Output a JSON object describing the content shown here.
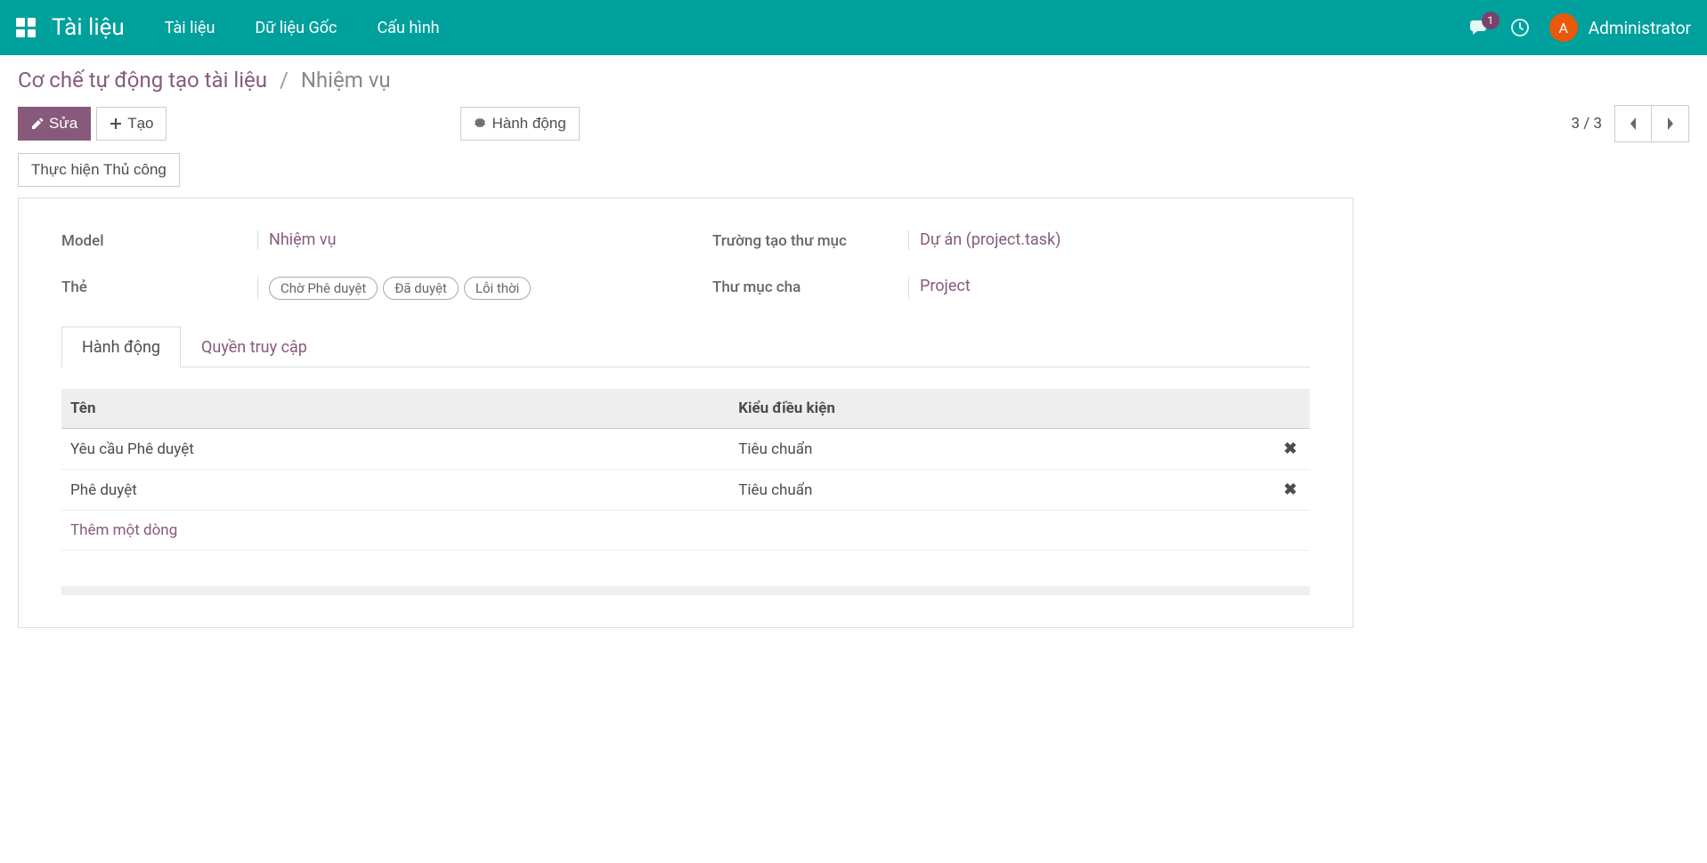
{
  "nav": {
    "brand": "Tài liệu",
    "menu": [
      "Tài liệu",
      "Dữ liệu Gốc",
      "Cấu hình"
    ],
    "badge_count": "1",
    "user_initial": "A",
    "user_name": "Administrator"
  },
  "breadcrumb": {
    "parent": "Cơ chế tự động tạo tài liệu",
    "current": "Nhiệm vụ"
  },
  "buttons": {
    "edit": "Sửa",
    "create": "Tạo",
    "action": "Hành động",
    "manual": "Thực hiện Thủ công"
  },
  "pager": {
    "text": "3 / 3"
  },
  "form": {
    "model_label": "Model",
    "model_value": "Nhiệm vụ",
    "tags_label": "Thẻ",
    "tags": [
      "Chờ Phê duyệt",
      "Đã duyệt",
      "Lỗi thời"
    ],
    "folder_field_label": "Trường tạo thư mục",
    "folder_field_value": "Dự án (project.task)",
    "parent_folder_label": "Thư mục cha",
    "parent_folder_value": "Project"
  },
  "tabs": {
    "actions": "Hành động",
    "access": "Quyền truy cập"
  },
  "table": {
    "col_name": "Tên",
    "col_cond": "Kiểu điều kiện",
    "rows": [
      {
        "name": "Yêu cầu Phê duyệt",
        "cond": "Tiêu chuẩn"
      },
      {
        "name": "Phê duyệt",
        "cond": "Tiêu chuẩn"
      }
    ],
    "add_line": "Thêm một dòng"
  }
}
